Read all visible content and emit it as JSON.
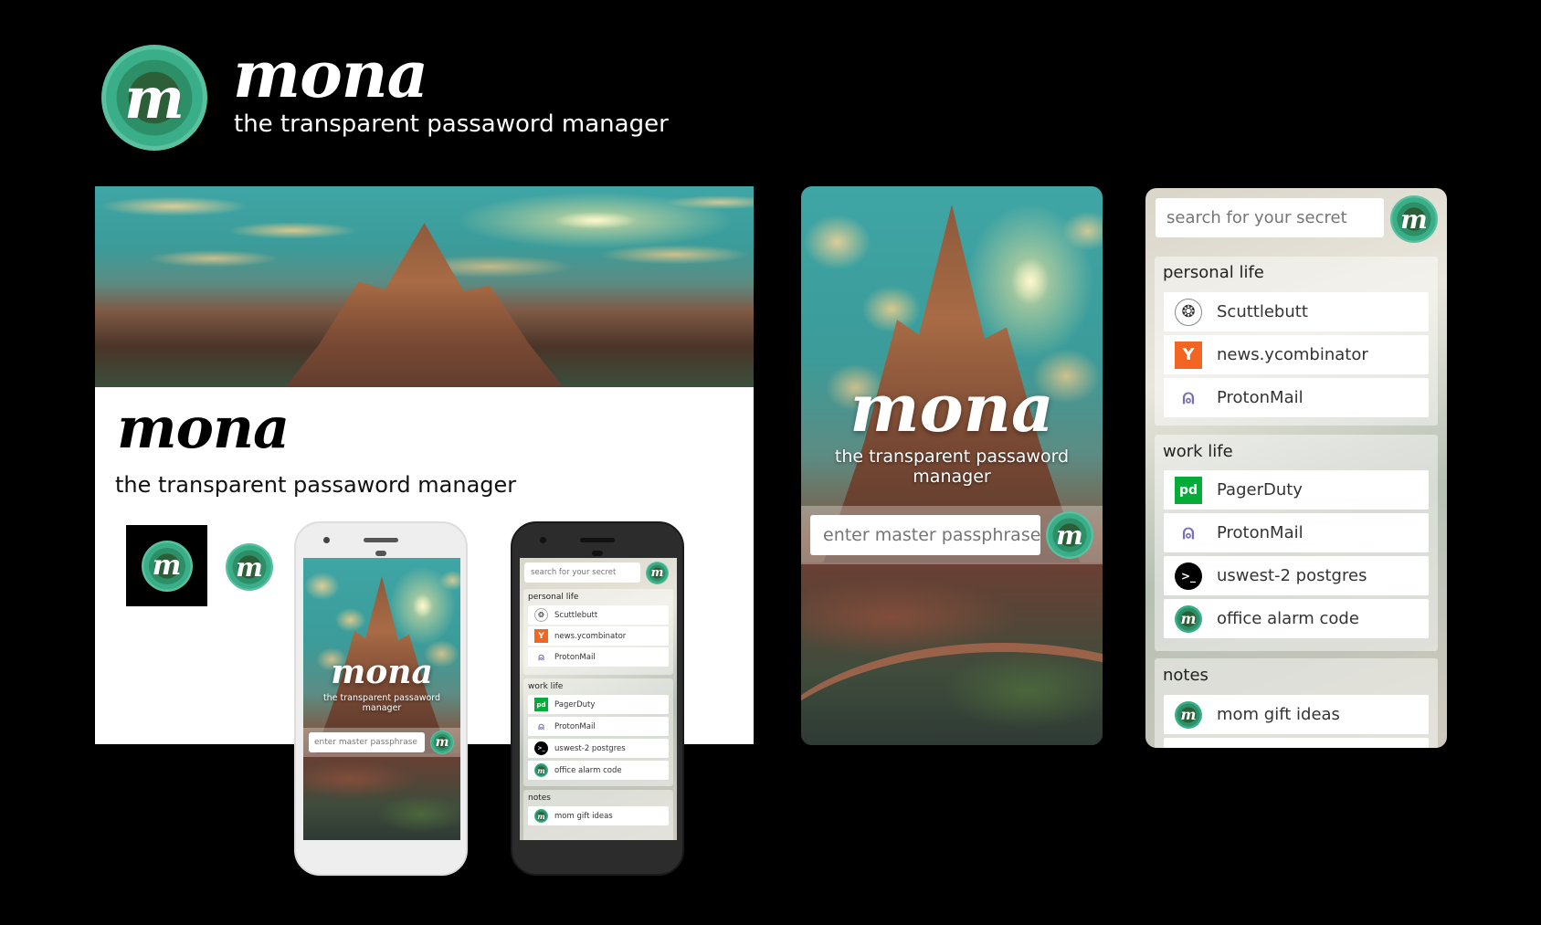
{
  "app": {
    "name": "mona",
    "tagline": "the transparent passaword manager",
    "logo_letter": "m"
  },
  "login": {
    "passphrase_placeholder": "enter master passphrase"
  },
  "list": {
    "search_placeholder": "search for your secret",
    "sections": [
      {
        "title": "personal life",
        "items": [
          {
            "label": "Scuttlebutt",
            "icon": "scuttlebutt-icon"
          },
          {
            "label": "news.ycombinator",
            "icon": "ycombinator-icon",
            "glyph": "Y"
          },
          {
            "label": "ProtonMail",
            "icon": "protonmail-icon"
          }
        ]
      },
      {
        "title": "work life",
        "items": [
          {
            "label": "PagerDuty",
            "icon": "pagerduty-icon",
            "glyph": "pd"
          },
          {
            "label": "ProtonMail",
            "icon": "protonmail-icon"
          },
          {
            "label": "uswest-2 postgres",
            "icon": "terminal-icon",
            "glyph": ">_"
          },
          {
            "label": "office alarm code",
            "icon": "mona-icon",
            "glyph": "m"
          }
        ]
      },
      {
        "title": "notes",
        "items": [
          {
            "label": "mom gift ideas",
            "icon": "mona-icon",
            "glyph": "m"
          }
        ]
      }
    ]
  },
  "colors": {
    "background": "#000000",
    "logo_ring": "#f3cf2a",
    "logo_green": "#2d8f67",
    "ycombinator": "#f26522",
    "pagerduty": "#06ac38",
    "protonmail": "#7a6fb0"
  }
}
